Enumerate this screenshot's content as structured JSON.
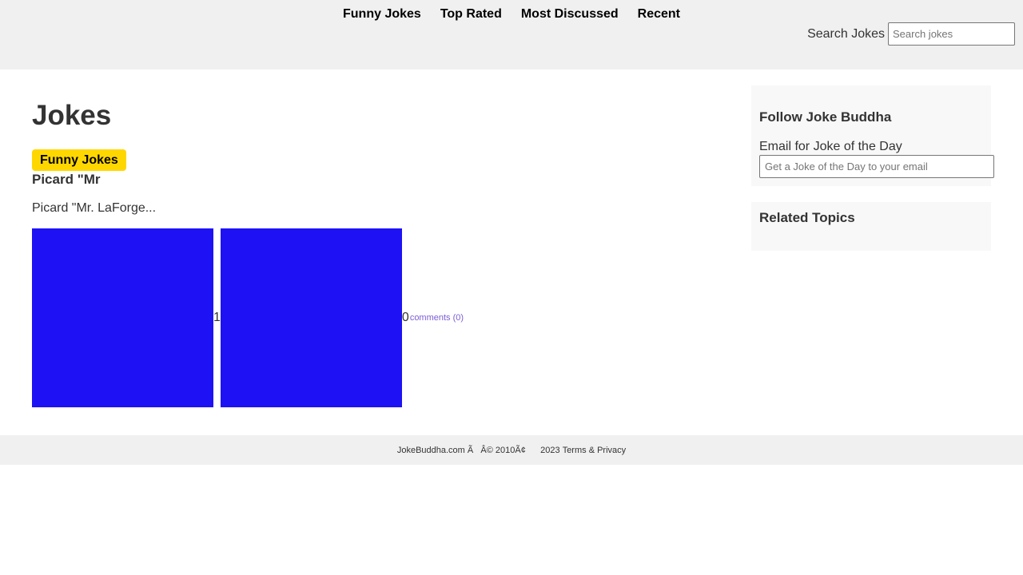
{
  "nav": {
    "items": [
      {
        "label": "Funny Jokes"
      },
      {
        "label": "Top Rated"
      },
      {
        "label": "Most Discussed"
      },
      {
        "label": "Recent"
      }
    ]
  },
  "search": {
    "label": "Search Jokes",
    "placeholder": "Search jokes"
  },
  "main": {
    "title": "Jokes",
    "category_tag": "Funny Jokes",
    "joke": {
      "title": "Picard \"Mr",
      "excerpt": "Picard \"Mr. LaForge...",
      "up_votes": "1",
      "down_votes": "0",
      "comments_label": "comments (0)"
    }
  },
  "sidebar": {
    "follow_heading": "Follow Joke Buddha",
    "email_label": "Email for Joke of the Day",
    "email_placeholder": "Get a Joke of the Day to your email",
    "related_heading": "Related Topics"
  },
  "footer": {
    "copyright": "JokeBuddha.com Ã   Â© 2010Ã¢      2023 ",
    "terms_link": "Terms & Privacy"
  },
  "colors": {
    "topbar_bg": "#f0f0f0",
    "tag_bg": "#ffd700",
    "vote_box": "#1e12f5",
    "link": "#7b5cd6",
    "sidebar_bg": "#f8f8f8"
  }
}
